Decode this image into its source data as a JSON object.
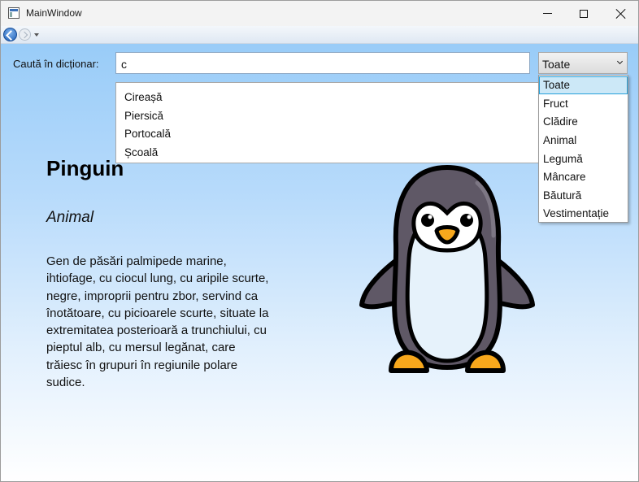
{
  "window": {
    "title": "MainWindow"
  },
  "search": {
    "label": "Caută în dicționar:",
    "value": "c"
  },
  "category_select": {
    "selected": "Toate",
    "options": [
      "Toate",
      "Fruct",
      "Clădire",
      "Animal",
      "Legumă",
      "Mâncare",
      "Băutură",
      "Vestimentație"
    ]
  },
  "suggestions": [
    "Cireașă",
    "Piersică",
    "Portocală",
    "Școală"
  ],
  "entry": {
    "title": "Pinguin",
    "category": "Animal",
    "description": "Gen de păsări palmipede marine, ihtiofage, cu ciocul lung, cu aripile scurte, negre, improprii pentru zbor, servind ca înotătoare, cu picioarele scurte, situate la extremitatea posterioară a trunchiului, cu pieptul alb, cu mersul legănat, care trăiesc în grupuri în regiunile polare sudice.",
    "image_icon": "penguin-icon"
  },
  "colors": {
    "background_top": "#99ccf8",
    "background_bottom": "#ffffff",
    "selection_highlight": "#cce8f7",
    "selection_border": "#26a0da"
  }
}
